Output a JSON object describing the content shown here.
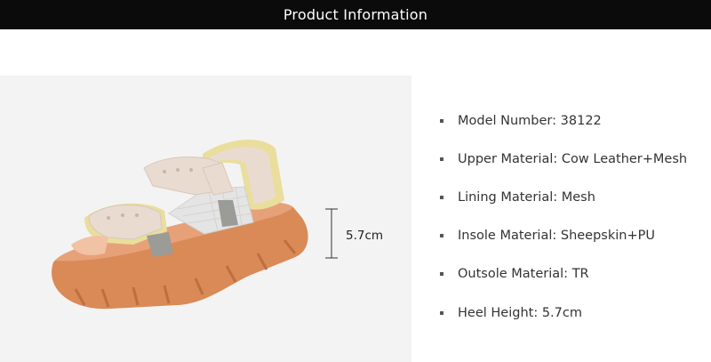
{
  "header": {
    "title": "Product Information"
  },
  "photo": {
    "subject": "sport-sandal-icon",
    "heel_height_label": "5.7cm",
    "colors": {
      "sole": "#d98a56",
      "upper": "#eadbd0",
      "trim": "#e9de9c",
      "insert": "#9b9b97"
    }
  },
  "specs": {
    "items": [
      {
        "label": "Model Number:",
        "value": "38122"
      },
      {
        "label": "Upper Material:",
        "value": "Cow Leather+Mesh"
      },
      {
        "label": "Lining Material:",
        "value": "Mesh"
      },
      {
        "label": "Insole Material:",
        "value": "Sheepskin+PU"
      },
      {
        "label": "Outsole Material:",
        "value": "TR"
      },
      {
        "label": "Heel Height:",
        "value": "5.7cm"
      }
    ]
  }
}
